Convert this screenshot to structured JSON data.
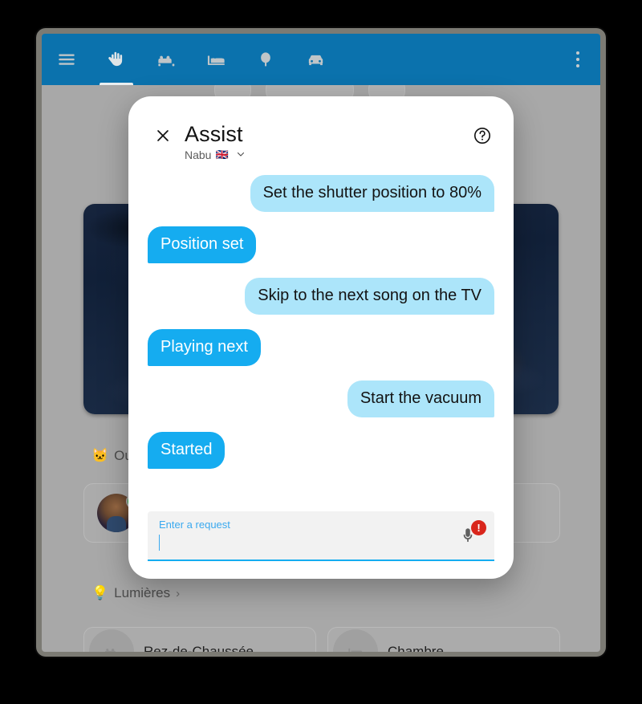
{
  "app_bar": {
    "menu_icon": "hamburger-menu-icon",
    "tabs": [
      {
        "icon": "waving-hand-icon",
        "name": "home",
        "active": true
      },
      {
        "icon": "sofa-icon",
        "name": "living-room",
        "active": false
      },
      {
        "icon": "bed-icon",
        "name": "bedroom",
        "active": false
      },
      {
        "icon": "tree-icon",
        "name": "outdoor",
        "active": false
      },
      {
        "icon": "car-icon",
        "name": "car",
        "active": false
      }
    ],
    "overflow_icon": "more-vertical-icon",
    "background_color": "#0b72ad"
  },
  "background": {
    "sections": [
      {
        "emoji": "🐱",
        "label": "Ou",
        "chevron": "›"
      },
      {
        "emoji": "💡",
        "label": "Lumières",
        "chevron": "›"
      }
    ],
    "rooms": [
      {
        "label": "Rez-de-Chaussée",
        "icon": "sofa-icon"
      },
      {
        "label": "Chambre",
        "icon": "bed-icon"
      }
    ]
  },
  "dialog": {
    "close_icon": "close-icon",
    "title": "Assist",
    "subtitle": "Nabu",
    "subtitle_flag": "🇬🇧",
    "subtitle_chevron": "⌄",
    "help_icon": "help-circle-icon",
    "colors": {
      "user_bubble": "#ace5fa",
      "assistant_bubble": "#15acf0",
      "accent": "#15acf0",
      "error": "#d9261c"
    }
  },
  "conversation": [
    {
      "role": "user",
      "text": "Set the shutter position to 80%"
    },
    {
      "role": "assistant",
      "text": "Position set"
    },
    {
      "role": "user",
      "text": "Skip to the next song on the TV"
    },
    {
      "role": "assistant",
      "text": "Playing next"
    },
    {
      "role": "user",
      "text": "Start the vacuum"
    },
    {
      "role": "assistant",
      "text": "Started"
    }
  ],
  "input": {
    "label": "Enter a request",
    "value": "",
    "mic_icon": "microphone-icon",
    "badge": "!"
  }
}
